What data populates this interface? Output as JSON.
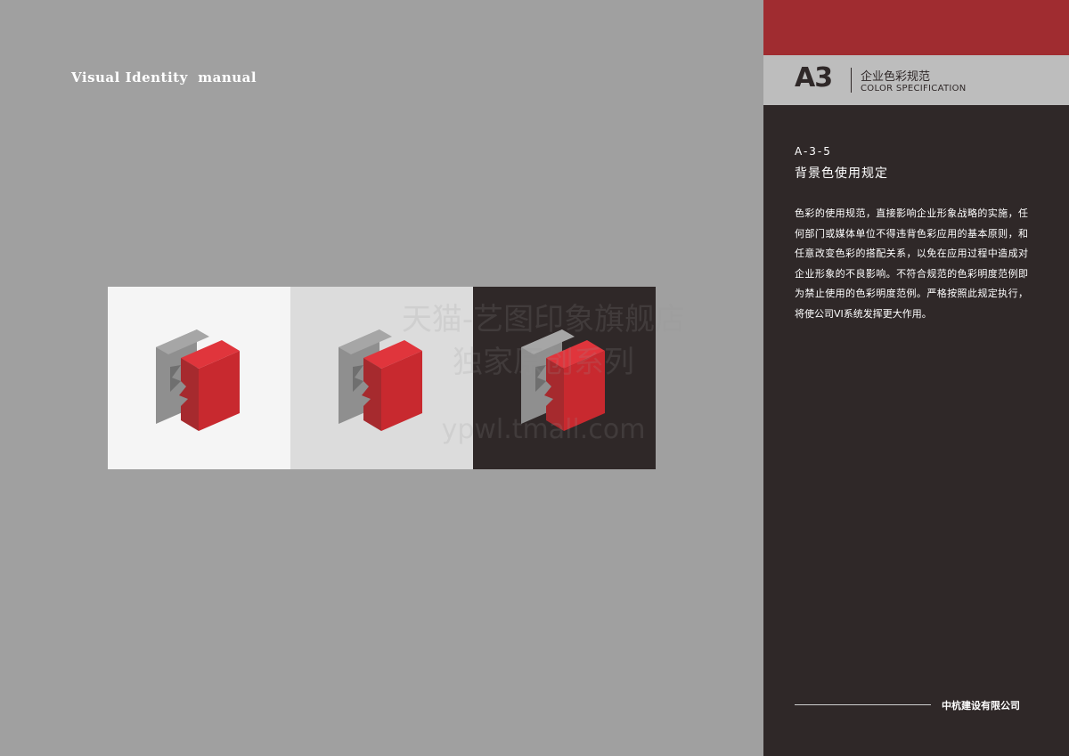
{
  "manual_title": "Visual Identity  manual",
  "watermark": {
    "line1": "天猫-艺图印象旗舰店",
    "line2": "独家原创系列",
    "url": "ypwl.tmall.com"
  },
  "swatches": [
    {
      "background": "#f5f5f5"
    },
    {
      "background": "#dcdcdc"
    },
    {
      "background": "#2f2828"
    }
  ],
  "logo_colors": {
    "red_front": "#a62a2e",
    "red_top": "#e0353c",
    "red_side": "#c8292f",
    "gray_front": "#8f8f8f",
    "gray_top": "#a6a6a6",
    "gray_side": "#7a7a7a"
  },
  "panel": {
    "accent_color": "#a02c30",
    "code": "A3",
    "title_cn": "企业色彩规范",
    "title_en": "COLOR SPECIFICATION",
    "section_code": "A-3-5",
    "section_title": "背景色使用规定",
    "body": "色彩的使用规范，直接影响企业形象战略的实施，任何部门或媒体单位不得违背色彩应用的基本原则，和任意改变色彩的搭配关系，以免在应用过程中造成对企业形象的不良影响。不符合规范的色彩明度范例即为禁止使用的色彩明度范例。严格按照此规定执行，将使公司VI系统发挥更大作用。",
    "company": "中杭建设有限公司"
  }
}
